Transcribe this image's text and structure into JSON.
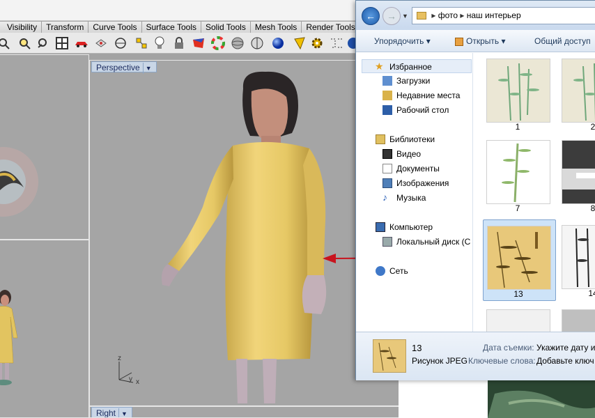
{
  "rhino": {
    "tabs": [
      "Visibility",
      "Transform",
      "Curve Tools",
      "Surface Tools",
      "Solid Tools",
      "Mesh Tools",
      "Render Tools"
    ],
    "viewports": {
      "perspective_label": "Perspective",
      "right_label": "Right",
      "axis_z": "z",
      "axis_y": "y",
      "axis_x": "x"
    },
    "toolbar_icons": [
      "zoom-window-icon",
      "zoom-extents-icon",
      "rotate-view-icon",
      "four-viewports-icon",
      "car-icon",
      "hidden-icon",
      "circle-icon",
      "snap-icon",
      "lightbulb-icon",
      "lock-icon",
      "render-icon",
      "color-wheel-icon",
      "sphere-icon",
      "shaded-sphere-icon",
      "blue-sphere-icon",
      "material-icon",
      "gear-icon",
      "dimension-icon"
    ]
  },
  "explorer": {
    "breadcrumb": [
      "фото",
      "наш интерьер"
    ],
    "commands": {
      "organize": "Упорядочить",
      "open": "Открыть",
      "share": "Общий доступ"
    },
    "nav": {
      "favorites": "Избранное",
      "downloads": "Загрузки",
      "recent": "Недавние места",
      "desktop": "Рабочий стол",
      "libraries": "Библиотеки",
      "video": "Видео",
      "documents": "Документы",
      "images": "Изображения",
      "music": "Музыка",
      "computer": "Компьютер",
      "local_disk": "Локальный диск (C",
      "network": "Сеть"
    },
    "files": [
      "1",
      "2",
      "7",
      "8",
      "13",
      "14"
    ],
    "details": {
      "name": "13",
      "type": "Рисунок JPEG",
      "date_label": "Дата съемки:",
      "date_value": "Укажите дату и",
      "keywords_label": "Ключевые слова:",
      "keywords_value": "Добавьте ключ"
    }
  },
  "colors": {
    "viewport_bg": "#a5a5a5",
    "dress": "#e3c56a",
    "arrow": "#c8141e",
    "selection": "#cde3f8"
  }
}
